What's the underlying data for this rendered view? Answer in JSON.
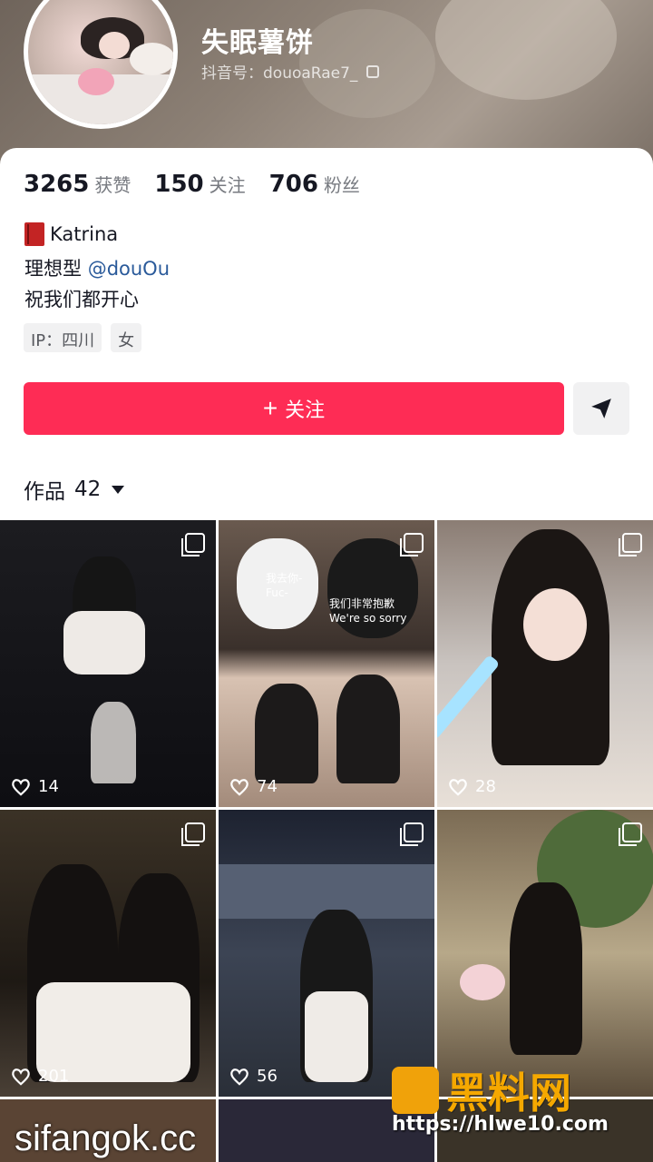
{
  "profile": {
    "name": "失眠薯饼",
    "douyin_id": "抖音号：douoaRae7_",
    "stats": [
      {
        "num": "3265",
        "label": "获赞"
      },
      {
        "num": "150",
        "label": "关注"
      },
      {
        "num": "706",
        "label": "粉丝"
      }
    ],
    "bio": {
      "line1": "Katrina",
      "line2_prefix": "理想型 ",
      "line2_mention": "@douOu",
      "line3": "祝我们都开心"
    },
    "tags": [
      "IP：四川",
      "女"
    ]
  },
  "actions": {
    "follow_label": "关注",
    "follow_plus": "+",
    "share_icon": "send-icon"
  },
  "works": {
    "label": "作品",
    "count": "42"
  },
  "grid": {
    "items": [
      {
        "likes": "14"
      },
      {
        "likes": "74",
        "caption1": "我去你-\nFuc-",
        "caption2": "我们非常抱歉\nWe're so sorry"
      },
      {
        "likes": "28"
      },
      {
        "likes": "201"
      },
      {
        "likes": "56"
      },
      {
        "likes": ""
      }
    ]
  },
  "watermark": {
    "text1": "sifangok.cc",
    "text2": "黑料网",
    "text3": "https://hlwe10.com"
  },
  "colors": {
    "accent": "#fe2c55",
    "text": "#161823",
    "muted": "#777a80",
    "mention": "#2a5a9a"
  }
}
